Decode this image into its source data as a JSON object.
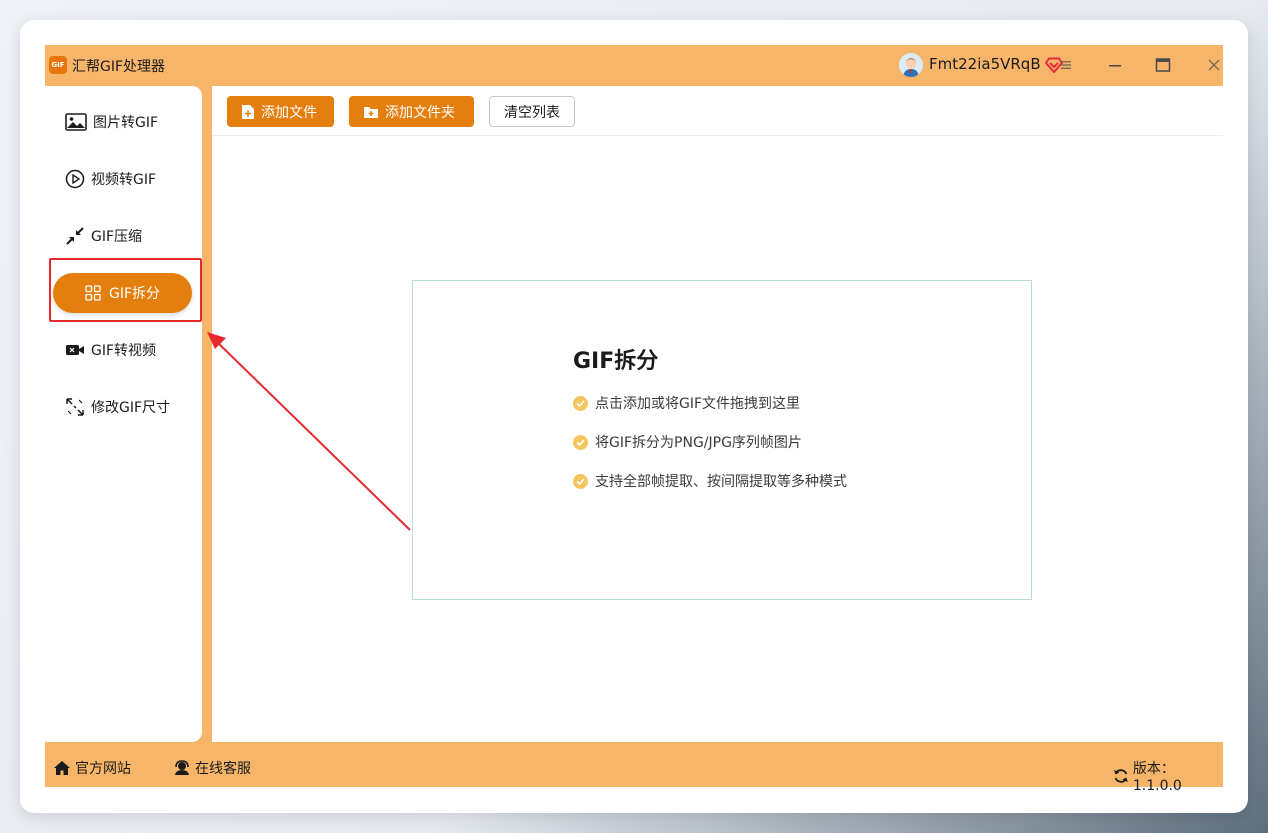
{
  "app": {
    "logo_text": "GIF",
    "title": "汇帮GIF处理器"
  },
  "user": {
    "name": "Fmt22ia5VRqB"
  },
  "sidebar": {
    "items": [
      {
        "label": "图片转GIF",
        "icon": "image-icon"
      },
      {
        "label": "视频转GIF",
        "icon": "play-circle-icon"
      },
      {
        "label": "GIF压缩",
        "icon": "compress-icon"
      },
      {
        "label": "GIF拆分",
        "icon": "grid-icon",
        "active": true
      },
      {
        "label": "GIF转视频",
        "icon": "video-camera-icon"
      },
      {
        "label": "修改GIF尺寸",
        "icon": "resize-icon"
      }
    ]
  },
  "toolbar": {
    "add_file": "添加文件",
    "add_folder": "添加文件夹",
    "clear_list": "清空列表"
  },
  "dropzone": {
    "title": "GIF拆分",
    "tips": [
      "点击添加或将GIF文件拖拽到这里",
      "将GIF拆分为PNG/JPG序列帧图片",
      "支持全部帧提取、按间隔提取等多种模式"
    ]
  },
  "footer": {
    "website": "官方网站",
    "support": "在线客服",
    "version": "版本：1.1.0.0"
  },
  "colors": {
    "accent": "#e47e0c",
    "frame": "#f7b56a",
    "highlight": "#e6282f",
    "check": "#f4c65e"
  }
}
